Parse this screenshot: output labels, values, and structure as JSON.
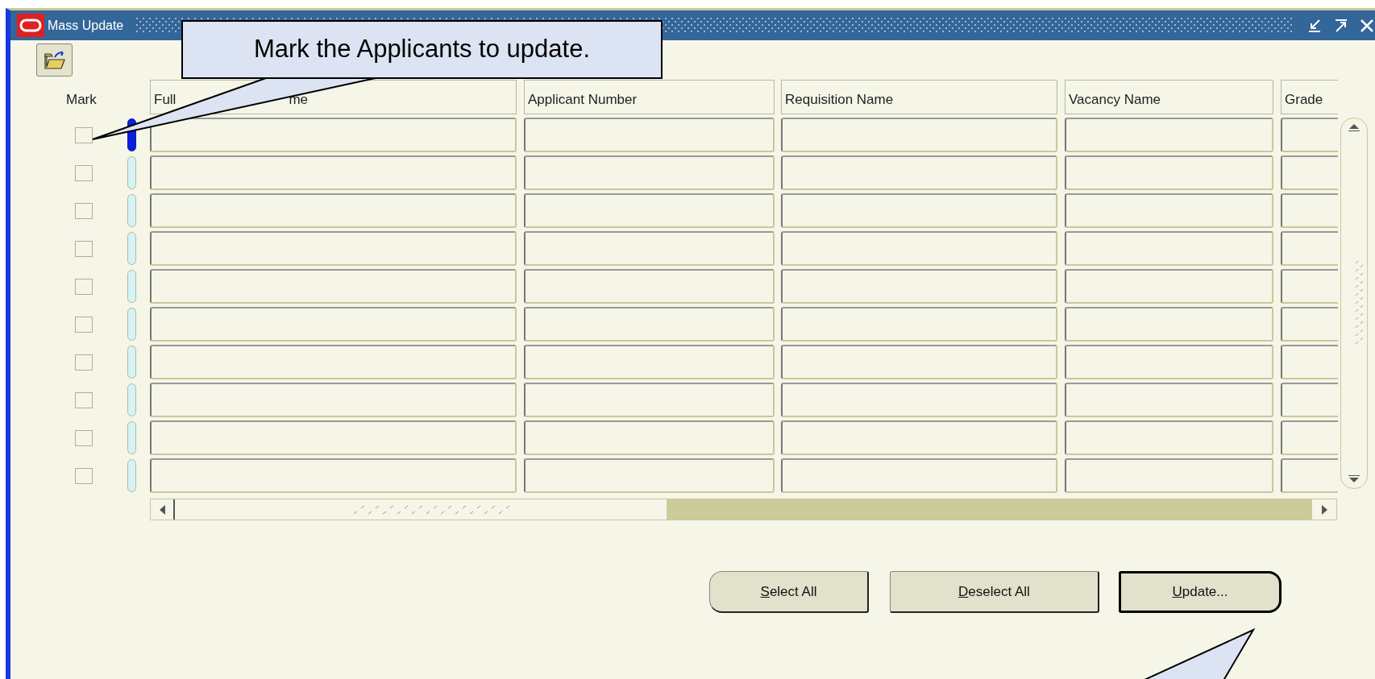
{
  "window": {
    "title": "Mass Update"
  },
  "mark_label": "Mark",
  "columns": [
    {
      "label": "Full",
      "label_end": "me"
    },
    {
      "label": "Applicant Number"
    },
    {
      "label": "Requisition Name"
    },
    {
      "label": "Vacancy Name"
    },
    {
      "label": "Grade"
    }
  ],
  "rows": [
    {
      "marked": false,
      "selected": true
    },
    {
      "marked": false,
      "selected": false
    },
    {
      "marked": false,
      "selected": false
    },
    {
      "marked": false,
      "selected": false
    },
    {
      "marked": false,
      "selected": false
    },
    {
      "marked": false,
      "selected": false
    },
    {
      "marked": false,
      "selected": false
    },
    {
      "marked": false,
      "selected": false
    },
    {
      "marked": false,
      "selected": false
    },
    {
      "marked": false,
      "selected": false
    }
  ],
  "buttons": [
    {
      "label": "Select All",
      "default": false
    },
    {
      "label": "Deselect All",
      "default": false
    },
    {
      "label": "Update...",
      "default": true
    }
  ],
  "callouts": [
    {
      "kind": "note",
      "text": "Mark the Applicants to update."
    },
    {
      "kind": "pointer"
    }
  ]
}
